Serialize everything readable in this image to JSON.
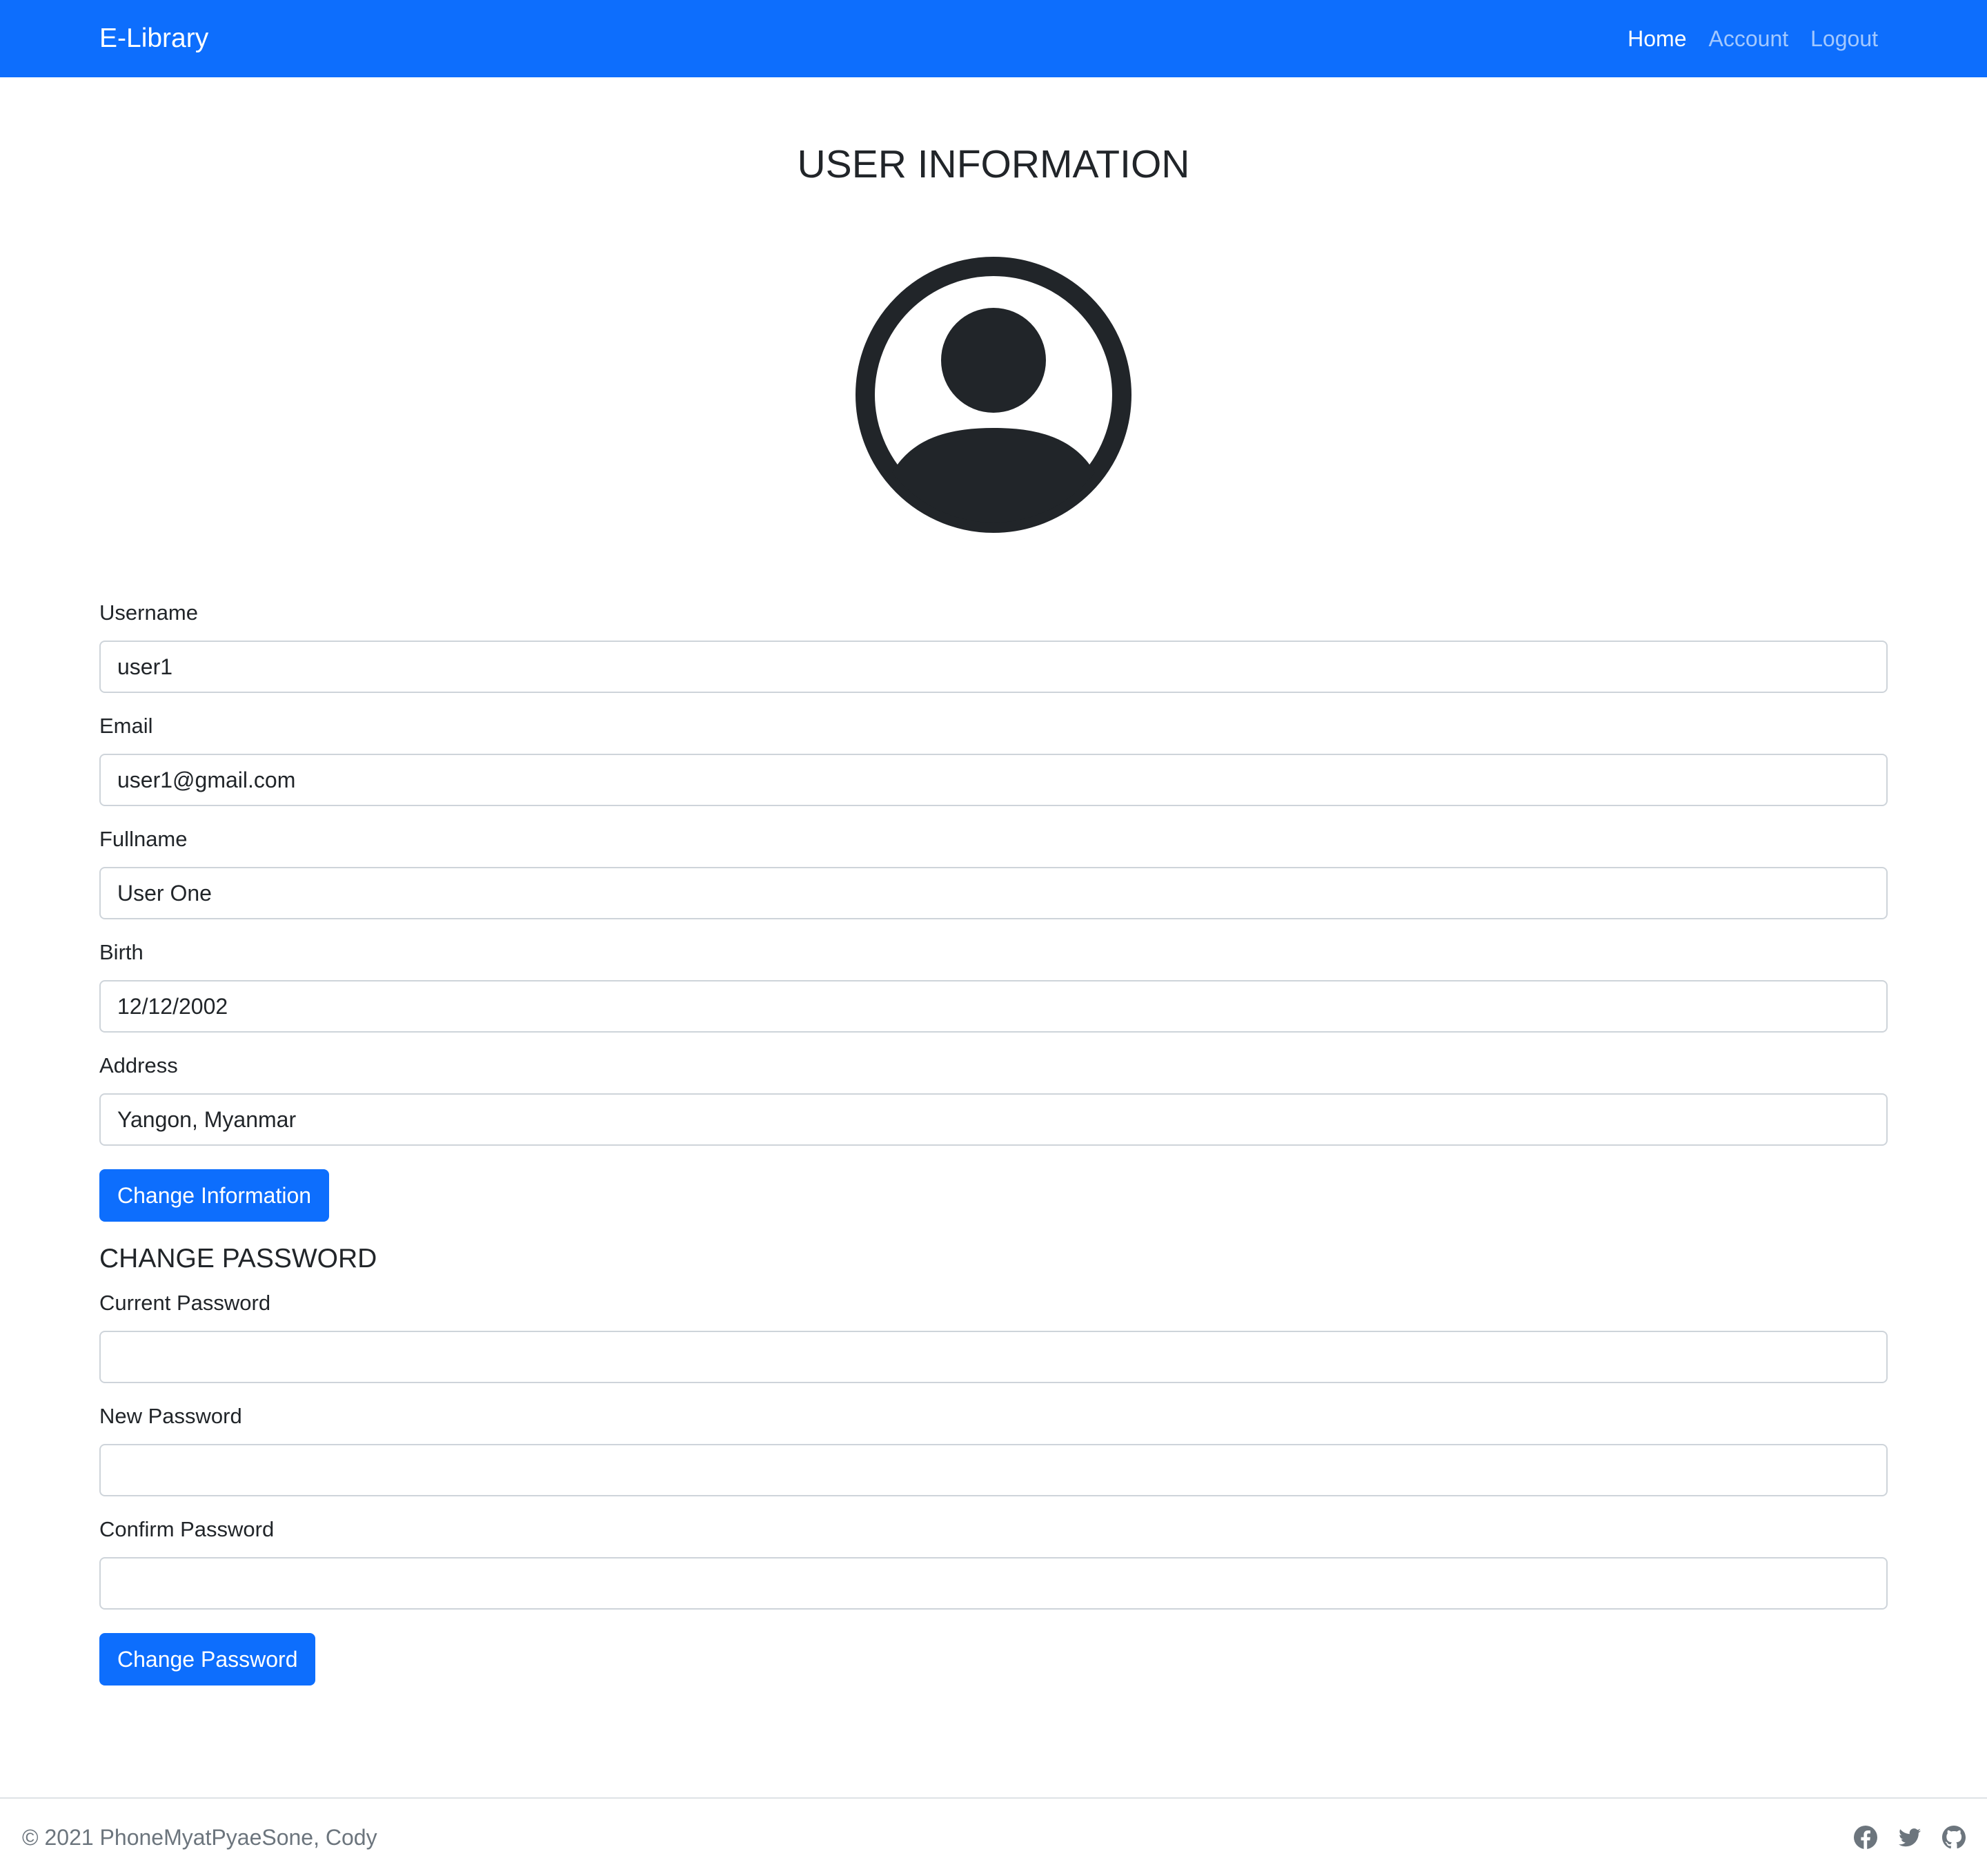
{
  "navbar": {
    "brand": "E-Library",
    "links": [
      "Home",
      "Account",
      "Logout"
    ],
    "active_link": "Home",
    "background_color": "#0d6efd"
  },
  "page": {
    "title": "USER INFORMATION",
    "avatar_icon": "person-circle-icon"
  },
  "user_info": {
    "fields": [
      {
        "label": "Username",
        "value": "user1"
      },
      {
        "label": "Email",
        "value": "user1@gmail.com"
      },
      {
        "label": "Fullname",
        "value": "User One"
      },
      {
        "label": "Birth",
        "value": "12/12/2002"
      },
      {
        "label": "Address",
        "value": "Yangon, Myanmar"
      }
    ],
    "submit_label": "Change Information"
  },
  "password": {
    "title": "CHANGE PASSWORD",
    "fields": [
      {
        "label": "Current Password",
        "value": ""
      },
      {
        "label": "New Password",
        "value": ""
      },
      {
        "label": "Confirm Password",
        "value": ""
      }
    ],
    "submit_label": "Change Password"
  },
  "footer": {
    "copyright": "© 2021 PhoneMyatPyaeSone, Cody",
    "social_icons": [
      "facebook-icon",
      "twitter-icon",
      "github-icon"
    ]
  },
  "colors": {
    "primary": "#0d6efd",
    "text": "#212529",
    "muted": "#6c757d"
  }
}
